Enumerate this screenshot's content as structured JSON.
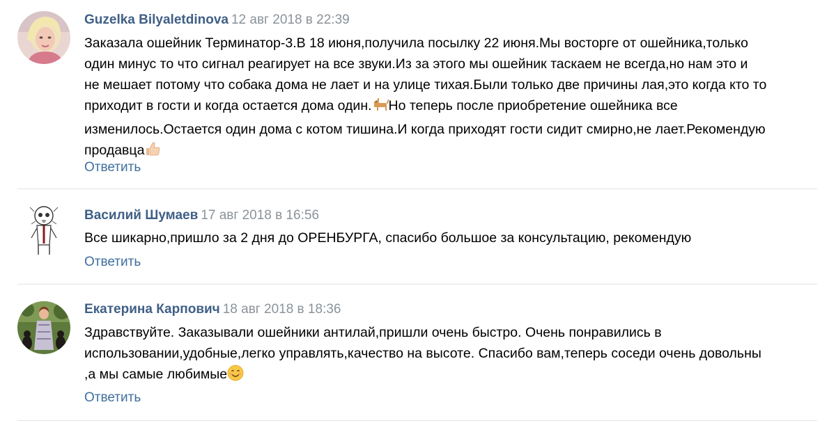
{
  "comments": [
    {
      "author": "Guzelka Bilyaletdinova",
      "date": "12 авг 2018 в 22:39",
      "text_lines": [
        "Заказала ошейник Терминатор-3.В 18 июня,получила посылку 22 июня.Мы восторге от ошейника,только",
        "один минус то что сигнал реагирует на все звуки.Из за этого мы ошейник таскаем не всегда,но нам это и",
        "не мешает потому что собака дома не лает и на улице тихая.Были только две причины лая,это когда кто то",
        "приходит в гости и когда остается дома один.",
        "Но теперь после приобретение ошейника все",
        "изменилось.Остается один дома с котом тишина.И когда приходят гости сидит смирно,не лает.Рекомендую",
        "продавца"
      ],
      "inline_icons": [
        "dog-emoji-icon",
        "thumbs-up-emoji-icon"
      ],
      "reply_label": "Ответить"
    },
    {
      "author": "Василий Шумаев",
      "date": "17 авг 2018 в 16:56",
      "text_lines": [
        "Все шикарно,пришло за 2 дня до ОРЕНБУРГА, спасибо большое за консультацию, рекомендую"
      ],
      "reply_label": "Ответить"
    },
    {
      "author": "Екатерина Карпович",
      "date": "18 авг 2018 в 18:36",
      "text_lines": [
        "Здравствуйте. Заказывали ошейники антилай,пришли очень быстро. Очень понравились в",
        "использовании,удобные,легко управлять,качество на высоте. Спасибо вам,теперь соседи очень довольны",
        ",а мы самые любимые"
      ],
      "inline_icons": [
        "smile-emoji-icon"
      ],
      "reply_label": "Ответить"
    }
  ],
  "colors": {
    "author": "#3f5f86",
    "date": "#8a9299",
    "reply": "#3f6f9e",
    "divider": "#dfe3e8",
    "text": "#000000"
  }
}
